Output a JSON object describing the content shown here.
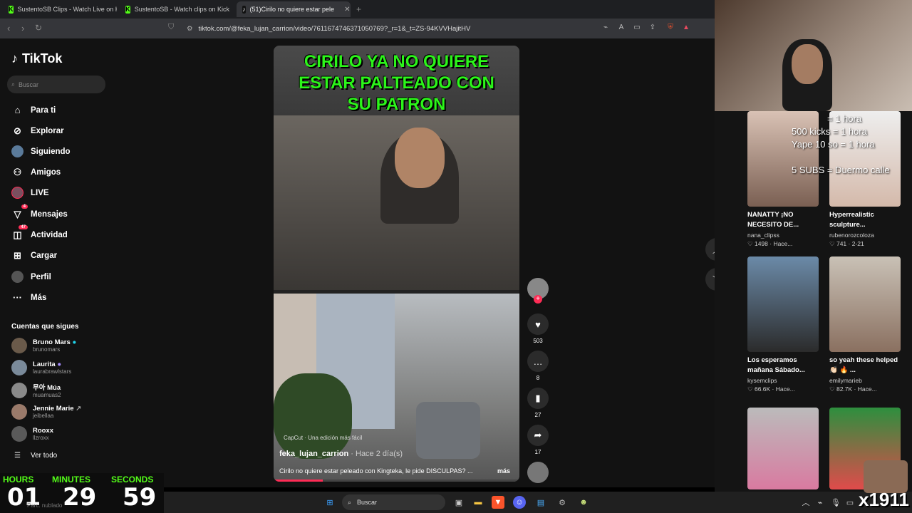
{
  "tabs": [
    {
      "label": "SustentoSB Clips - Watch Live on Kick",
      "icon": "kick-icon"
    },
    {
      "label": "SustentoSB - Watch clips on Kick",
      "icon": "kick-icon"
    },
    {
      "label": "(51)Cirilo no quiere estar pele",
      "icon": "tiktok-icon"
    }
  ],
  "url": "tiktok.com/@feka_lujan_carrion/video/7611674746371050769?_r=1&_t=ZS-94KVVHajitHV",
  "sidebar": {
    "logo": "TikTok",
    "search_placeholder": "Buscar",
    "nav": [
      {
        "label": "Para ti",
        "icon": "home-icon"
      },
      {
        "label": "Explorar",
        "icon": "compass-icon"
      },
      {
        "label": "Siguiendo",
        "icon": "following-icon"
      },
      {
        "label": "Amigos",
        "icon": "friends-icon"
      },
      {
        "label": "LIVE",
        "icon": "live-icon"
      },
      {
        "label": "Mensajes",
        "icon": "messages-icon",
        "badge": "4"
      },
      {
        "label": "Actividad",
        "icon": "activity-icon",
        "badge": "47"
      },
      {
        "label": "Cargar",
        "icon": "upload-icon"
      },
      {
        "label": "Perfil",
        "icon": "profile-icon"
      },
      {
        "label": "Más",
        "icon": "more-icon"
      }
    ],
    "following_title": "Cuentas que sigues",
    "accounts": [
      {
        "name": "Bruno Mars",
        "handle": "brunomars"
      },
      {
        "name": "Laurita",
        "handle": "laurabrawlstars"
      },
      {
        "name": "무아 Múa",
        "handle": "muamuas2"
      },
      {
        "name": "Jennie Marie",
        "handle": "jeibellaa"
      },
      {
        "name": "Rooxx",
        "handle": "llzroxx"
      }
    ],
    "see_all": "Ver todo"
  },
  "video": {
    "title_lines": [
      "CIRILO YA NO QUIERE",
      "ESTAR PALTEADO CON",
      "SU PATRON"
    ],
    "capcut": "CapCut · Una edición más fácil",
    "author": "feka_lujan_carrion",
    "time": " · Hace 2 día(s)",
    "caption": "Cirilo no quiere estar peleado con Kingteka, le pide DISCULPAS? ...",
    "more": "más",
    "progress": 0.2
  },
  "actions": {
    "likes": "503",
    "comments": "8",
    "saves": "27",
    "shares": "17"
  },
  "clips": [
    {
      "title": "NANATTY ¡NO NECESITO DE...",
      "user": "nana_clipss",
      "stats": "♡ 1498 · Hace..."
    },
    {
      "title": "Hyperrealistic sculpture...",
      "user": "rubenorozcoloza",
      "stats": "♡ 741 · 2-21"
    },
    {
      "title": "Los esperamos mañana Sábado...",
      "user": "kysemclips",
      "stats": "♡ 66.6K · Hace..."
    },
    {
      "title": "so yeah these helped 👏🏻 🔥 ...",
      "user": "emilymarieb",
      "stats": "♡ 82.7K · Hace..."
    }
  ],
  "overlay_text": [
    "= 1 hora",
    "500 kicks = 1 hora",
    "Yape 10 so = 1 hora",
    "5 SUBS = Duermo calle"
  ],
  "timer": {
    "hours_label": "HOURS",
    "minutes_label": "MINUTES",
    "seconds_label": "SECONDS",
    "hours": "01",
    "minutes": "29",
    "seconds": "59",
    "weather": "Parc. nublado"
  },
  "taskbar": {
    "search": "Buscar"
  },
  "watermark": "x1911",
  "colors": {
    "accent": "#fe2c55",
    "kick_green": "#53fc18",
    "title_green": "#2cf51a"
  }
}
